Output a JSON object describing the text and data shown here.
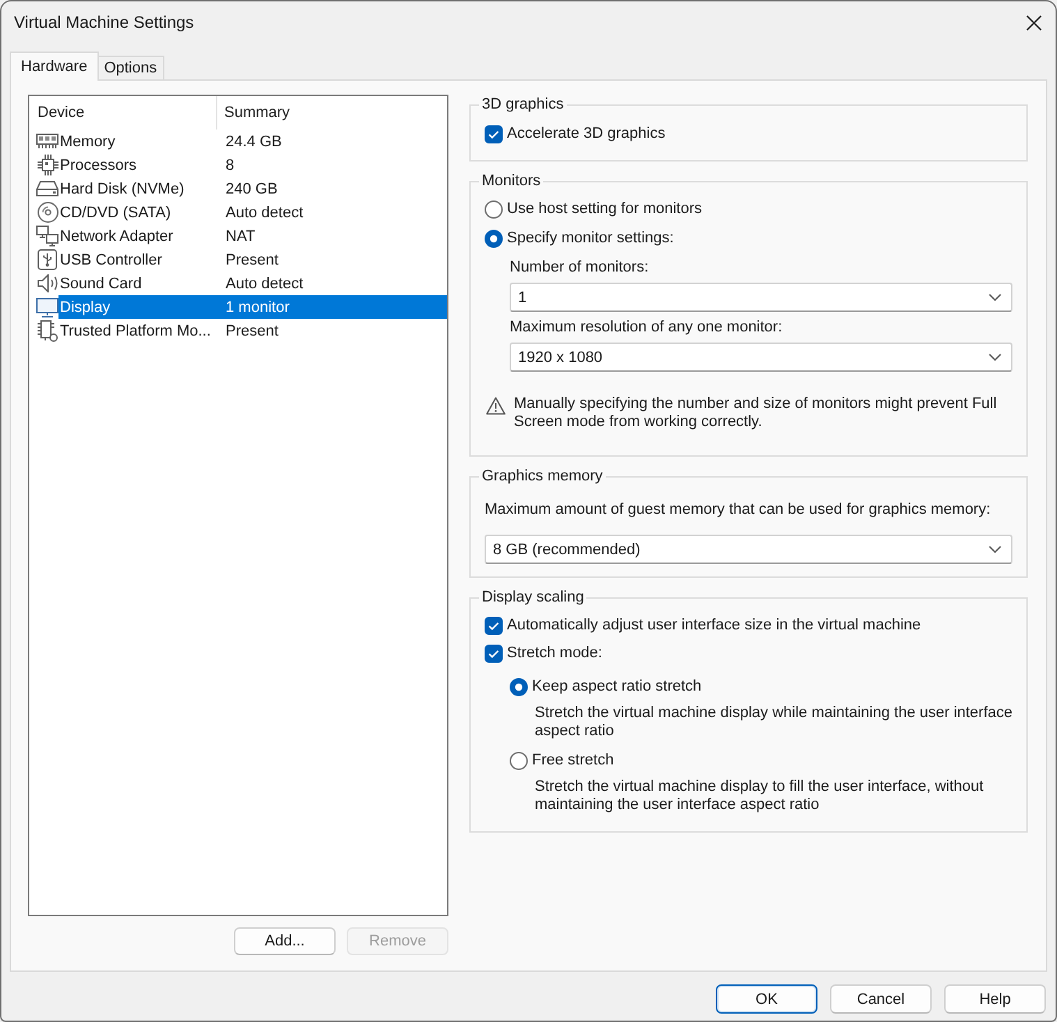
{
  "window": {
    "title": "Virtual Machine Settings"
  },
  "tabs": [
    {
      "label": "Hardware",
      "selected": true
    },
    {
      "label": "Options",
      "selected": false
    }
  ],
  "device_list": {
    "columns": [
      "Device",
      "Summary"
    ],
    "rows": [
      {
        "kind": "memory",
        "device": "Memory",
        "summary": "24.4 GB",
        "selected": false
      },
      {
        "kind": "processor",
        "device": "Processors",
        "summary": "8",
        "selected": false
      },
      {
        "kind": "hard_disk",
        "device": "Hard Disk (NVMe)",
        "summary": "240 GB",
        "selected": false
      },
      {
        "kind": "cd_dvd",
        "device": "CD/DVD (SATA)",
        "summary": "Auto detect",
        "selected": false
      },
      {
        "kind": "network",
        "device": "Network Adapter",
        "summary": "NAT",
        "selected": false
      },
      {
        "kind": "usb",
        "device": "USB Controller",
        "summary": "Present",
        "selected": false
      },
      {
        "kind": "sound",
        "device": "Sound Card",
        "summary": "Auto detect",
        "selected": false
      },
      {
        "kind": "display",
        "device": "Display",
        "summary": "1 monitor",
        "selected": true
      },
      {
        "kind": "tpm",
        "device": "Trusted Platform Mo...",
        "summary": "Present",
        "selected": false
      }
    ]
  },
  "list_buttons": [
    {
      "label": "Add...",
      "disabled": false
    },
    {
      "label": "Remove",
      "disabled": true
    }
  ],
  "graphics_3d": {
    "title": "3D graphics",
    "accelerate": {
      "label": "Accelerate 3D graphics",
      "checked": true
    }
  },
  "monitors": {
    "title": "Monitors",
    "modes": [
      {
        "label": "Use host setting for monitors",
        "selected": false
      },
      {
        "label": "Specify monitor settings:",
        "selected": true
      }
    ],
    "count_label": "Number of monitors:",
    "count_value": "1",
    "resolution_label": "Maximum resolution of any one monitor:",
    "resolution_value": "1920 x 1080",
    "warning": "Manually specifying the number and size of monitors might prevent Full Screen mode from working correctly."
  },
  "graphics_memory": {
    "title": "Graphics memory",
    "label": "Maximum amount of guest memory that can be used for graphics memory:",
    "value": "8 GB (recommended)"
  },
  "display_scaling": {
    "title": "Display scaling",
    "auto_adjust": {
      "label": "Automatically adjust user interface size in the virtual machine",
      "checked": true
    },
    "stretch_mode": {
      "label": "Stretch mode:",
      "checked": true
    },
    "stretch_options": [
      {
        "label": "Keep aspect ratio stretch",
        "selected": true,
        "description": "Stretch the virtual machine display while maintaining the user interface aspect ratio"
      },
      {
        "label": "Free stretch",
        "selected": false,
        "description": "Stretch the virtual machine display to fill the user interface, without maintaining the user interface aspect ratio"
      }
    ]
  },
  "dialog_buttons": [
    {
      "label": "OK",
      "default": true
    },
    {
      "label": "Cancel",
      "default": false
    },
    {
      "label": "Help",
      "default": false
    }
  ]
}
